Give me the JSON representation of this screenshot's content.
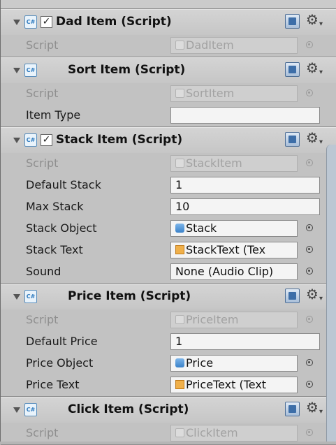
{
  "components": [
    {
      "title": "Dad Item (Script)",
      "enabled": true,
      "fields": [
        {
          "label": "Script",
          "value": "DadItem",
          "icon": "script-file-icon",
          "disabled": true,
          "picker": true
        }
      ]
    },
    {
      "title": "Sort Item (Script)",
      "enabled": null,
      "fields": [
        {
          "label": "Script",
          "value": "SortItem",
          "icon": "script-file-icon",
          "disabled": true,
          "picker": true
        },
        {
          "label": "Item Type",
          "value": "",
          "disabled": false,
          "picker": false
        }
      ]
    },
    {
      "title": "Stack Item (Script)",
      "enabled": true,
      "fields": [
        {
          "label": "Script",
          "value": "StackItem",
          "icon": "script-file-icon",
          "disabled": true,
          "picker": true
        },
        {
          "label": "Default Stack",
          "value": "1",
          "disabled": false,
          "picker": false
        },
        {
          "label": "Max Stack",
          "value": "10",
          "disabled": false,
          "picker": false
        },
        {
          "label": "Stack Object",
          "value": "Stack",
          "icon": "prefab-icon",
          "disabled": false,
          "picker": true
        },
        {
          "label": "Stack Text",
          "value": "StackText (Tex",
          "icon": "text-component-icon",
          "disabled": false,
          "picker": true
        },
        {
          "label": "Sound",
          "value": "None (Audio Clip)",
          "disabled": false,
          "picker": true
        }
      ]
    },
    {
      "title": "Price Item (Script)",
      "enabled": null,
      "fields": [
        {
          "label": "Script",
          "value": "PriceItem",
          "icon": "script-file-icon",
          "disabled": true,
          "picker": true
        },
        {
          "label": "Default Price",
          "value": "1",
          "disabled": false,
          "picker": false
        },
        {
          "label": "Price Object",
          "value": "Price",
          "icon": "prefab-icon",
          "disabled": false,
          "picker": true
        },
        {
          "label": "Price Text",
          "value": "PriceText (Text",
          "icon": "text-component-icon",
          "disabled": false,
          "picker": true
        }
      ]
    },
    {
      "title": "Click Item (Script)",
      "enabled": null,
      "fields": [
        {
          "label": "Script",
          "value": "ClickItem",
          "icon": "script-file-icon",
          "disabled": true,
          "picker": true
        }
      ]
    }
  ],
  "icons": {
    "script_badge": "C#",
    "checkmark": "✓",
    "gear": "⚙",
    "gear_caret": "▾"
  },
  "colors": {
    "panel": "#c2c2c2",
    "header": "#cbcbcb",
    "field": "#f4f4f4",
    "disabled_text": "#8f8f8f",
    "scrollbar": "#bcc7d3"
  }
}
